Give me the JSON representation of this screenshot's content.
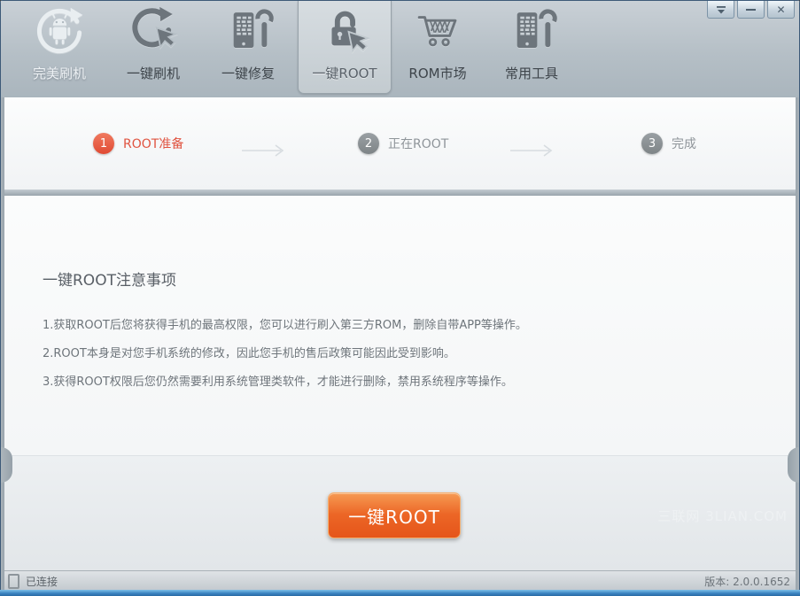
{
  "toolbar": {
    "logo": {
      "label": "完美刷机"
    },
    "tabs": [
      {
        "label": "一键刷机",
        "icon": "refresh-hand-icon",
        "selected": false
      },
      {
        "label": "一键修复",
        "icon": "phone-wrench-icon",
        "selected": false
      },
      {
        "label": "一键ROOT",
        "icon": "lock-hand-icon",
        "selected": true
      },
      {
        "label": "ROM市场",
        "icon": "cart-icon",
        "selected": false
      },
      {
        "label": "常用工具",
        "icon": "phone-wrench-icon",
        "selected": false
      }
    ]
  },
  "window_controls": {
    "close_glyph": "✕"
  },
  "steps": [
    {
      "number": "1",
      "label": "ROOT准备",
      "active": true
    },
    {
      "number": "2",
      "label": "正在ROOT",
      "active": false
    },
    {
      "number": "3",
      "label": "完成",
      "active": false
    }
  ],
  "content": {
    "title": "一键ROOT注意事项",
    "notes": [
      "1.获取ROOT后您将获得手机的最高权限，您可以进行刷入第三方ROM，删除自带APP等操作。",
      "2.ROOT本身是对您手机系统的修改，因此您手机的售后政策可能因此受到影响。",
      "3.获得ROOT权限后您仍然需要利用系统管理类软件，才能进行删除，禁用系统程序等操作。"
    ],
    "action_button": "一键ROOT",
    "watermark": "三联网 3LIAN.COM"
  },
  "statusbar": {
    "connection": "已连接",
    "version": "版本: 2.0.0.1652"
  },
  "colors": {
    "step_active": "#e05340",
    "step_inactive": "#8f959a",
    "button_orange_top": "#f69a52",
    "button_orange_bottom": "#e5551a",
    "toolbar_bg": "#b5bfc6"
  }
}
